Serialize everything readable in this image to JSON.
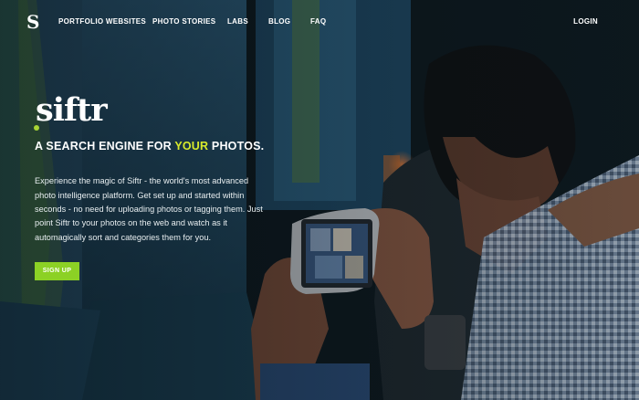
{
  "nav": {
    "logo": "S",
    "links": [
      "PORTFOLIO WEBSITES",
      "PHOTO STORIES",
      "LABS",
      "BLOG",
      "FAQ"
    ],
    "login": "LOGIN"
  },
  "hero": {
    "brand": "siftr",
    "headline_pre": "A SEARCH ENGINE FOR ",
    "headline_highlight": "YOUR",
    "headline_post": " PHOTOS.",
    "description": "Experience the magic of Siftr - the world's most advanced photo intelligence platform. Get set up and started within seconds - no need for uploading photos or tagging them. Just point Siftr to your photos on the web and watch as it automagically sort and categories them for you.",
    "cta": "SIGN UP"
  },
  "colors": {
    "accent_green": "#8cd125",
    "highlight_yellow": "#d8ea2c"
  }
}
